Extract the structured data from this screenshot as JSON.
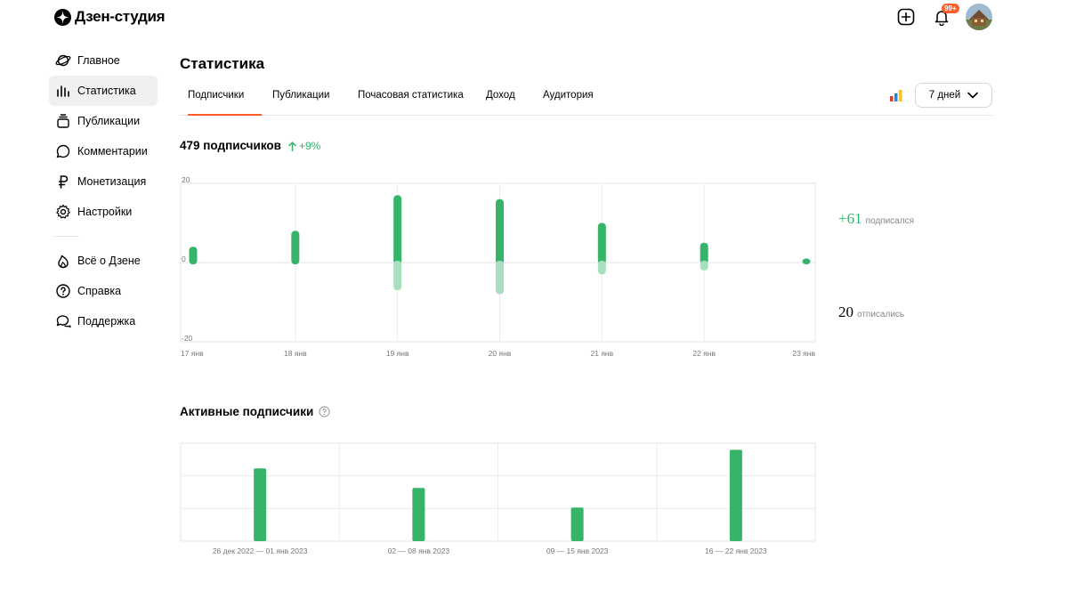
{
  "app": {
    "title": "Дзен-студия"
  },
  "header": {
    "icons": [
      "add-icon",
      "bell-icon"
    ],
    "notification_badge": "99+"
  },
  "sidebar": {
    "items": [
      {
        "label": "Главное",
        "icon": "planet-icon"
      },
      {
        "label": "Статистика",
        "icon": "bar-chart-icon",
        "active": true
      },
      {
        "label": "Публикации",
        "icon": "stack-icon"
      },
      {
        "label": "Комментарии",
        "icon": "comment-icon"
      },
      {
        "label": "Монетизация",
        "icon": "ruble-icon"
      },
      {
        "label": "Настройки",
        "icon": "gear-icon"
      }
    ],
    "secondary_items": [
      {
        "label": "Всё о Дзене",
        "icon": "flame-icon"
      },
      {
        "label": "Справка",
        "icon": "help-icon"
      },
      {
        "label": "Поддержка",
        "icon": "chat-icon"
      }
    ]
  },
  "page": {
    "title": "Статистика"
  },
  "tabs": [
    {
      "label": "Подписчики",
      "active": true
    },
    {
      "label": "Публикации"
    },
    {
      "label": "Почасовая статистика"
    },
    {
      "label": "Доход"
    },
    {
      "label": "Аудитория"
    }
  ],
  "period": {
    "selected": "7 дней"
  },
  "colors": {
    "accent": "#ff5c26",
    "green": "#35b46a",
    "green_light": "#a8e0bf"
  },
  "subscribers": {
    "total_label": "479 подписчиков",
    "growth": "+9%",
    "subscribed_value": "+61",
    "subscribed_caption": "подписался",
    "unsubscribed_value": "20",
    "unsubscribed_caption": "отписались"
  },
  "active_section": {
    "title": "Активные подписчики"
  },
  "chart_data": [
    {
      "type": "bar",
      "title": "",
      "categories": [
        "17 янв",
        "18 янв",
        "19 янв",
        "20 янв",
        "21 янв",
        "22 янв",
        "23 янв"
      ],
      "series": [
        {
          "name": "",
          "values": [
            4,
            8,
            17,
            16,
            10,
            5,
            1
          ]
        },
        {
          "name": "",
          "values": [
            0,
            0,
            -7,
            -8,
            -3,
            -2,
            0
          ]
        }
      ],
      "ylim": [
        -20,
        20
      ],
      "yticks": [
        "20",
        "0",
        "-20"
      ],
      "grid": true
    },
    {
      "type": "bar",
      "title": "",
      "categories": [
        "26 дек 2022 — 01 янв 2023",
        "02 — 08 янв 2023",
        "09 — 15 янв 2023",
        "16 — 22 янв 2023"
      ],
      "values": [
        78,
        57,
        36,
        98
      ],
      "ylim": [
        0,
        105
      ],
      "grid": true
    }
  ]
}
